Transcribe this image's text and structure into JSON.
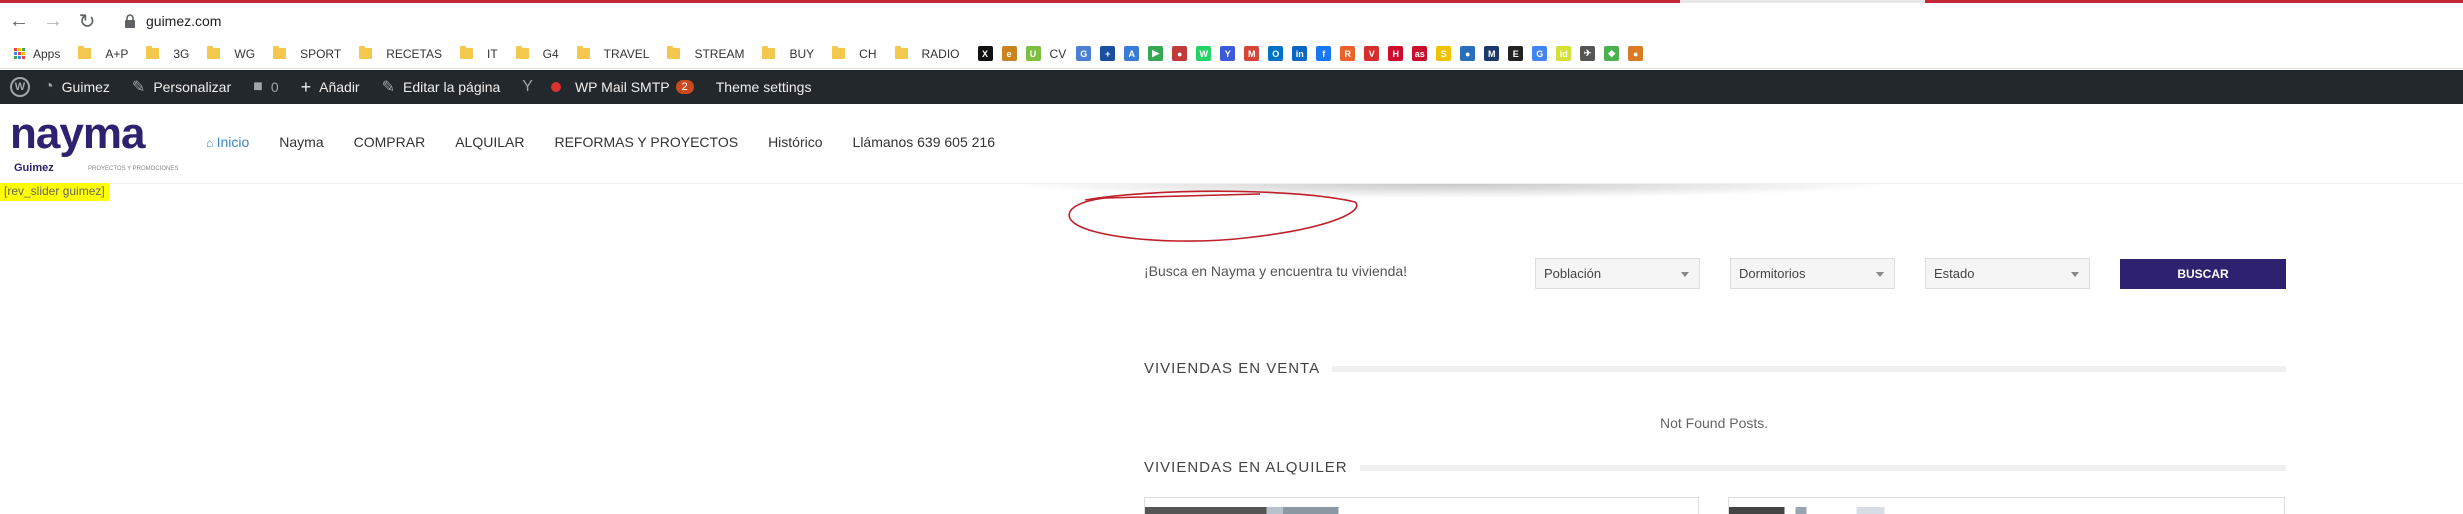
{
  "browser": {
    "url": "guimez.com"
  },
  "bookmarks": [
    {
      "label": "Apps",
      "kind": "apps"
    },
    {
      "label": "A+P",
      "kind": "folder"
    },
    {
      "label": "3G",
      "kind": "folder"
    },
    {
      "label": "WG",
      "kind": "folder"
    },
    {
      "label": "SPORT",
      "kind": "folder"
    },
    {
      "label": "RECETAS",
      "kind": "folder"
    },
    {
      "label": "IT",
      "kind": "folder"
    },
    {
      "label": "G4",
      "kind": "folder"
    },
    {
      "label": "TRAVEL",
      "kind": "folder"
    },
    {
      "label": "STREAM",
      "kind": "folder"
    },
    {
      "label": "BUY",
      "kind": "folder"
    },
    {
      "label": "CH",
      "kind": "folder"
    },
    {
      "label": "RADIO",
      "kind": "folder"
    }
  ],
  "bookmark_icons": [
    {
      "glyph": "X",
      "color": "#111111"
    },
    {
      "glyph": "e",
      "color": "#c9841f"
    },
    {
      "glyph": "U",
      "color": "#7fbf3f",
      "label": "CV"
    },
    {
      "glyph": "G",
      "color": "#4a7fd4"
    },
    {
      "glyph": "+",
      "color": "#1a4fa0"
    },
    {
      "glyph": "A",
      "color": "#3a7bd5"
    },
    {
      "glyph": "▶",
      "color": "#34a853"
    },
    {
      "glyph": "●",
      "color": "#c23b3b"
    },
    {
      "glyph": "W",
      "color": "#25d366"
    },
    {
      "glyph": "Y",
      "color": "#3b5bdb"
    },
    {
      "glyph": "M",
      "color": "#d44638"
    },
    {
      "glyph": "O",
      "color": "#0072c6"
    },
    {
      "glyph": "in",
      "color": "#0a66c2"
    },
    {
      "glyph": "f",
      "color": "#1877f2"
    },
    {
      "glyph": "R",
      "color": "#e8632b"
    },
    {
      "glyph": "V",
      "color": "#d62d2d"
    },
    {
      "glyph": "H",
      "color": "#cf0a2c"
    },
    {
      "glyph": "as",
      "color": "#c8102e"
    },
    {
      "glyph": "S",
      "color": "#f2c200"
    },
    {
      "glyph": "●",
      "color": "#2a6fbb"
    },
    {
      "glyph": "M",
      "color": "#1b3a6b"
    },
    {
      "glyph": "E",
      "color": "#222222"
    },
    {
      "glyph": "G",
      "color": "#4285f4"
    },
    {
      "glyph": "id",
      "color": "#d2e038"
    },
    {
      "glyph": "✈",
      "color": "#555555"
    },
    {
      "glyph": "◆",
      "color": "#4caf50"
    },
    {
      "glyph": "●",
      "color": "#d97b22"
    }
  ],
  "adminbar": {
    "site": "Guimez",
    "customize": "Personalizar",
    "comments_count": "0",
    "new": "Añadir",
    "edit_page": "Editar la página",
    "wp_mail": "WP Mail SMTP",
    "wp_mail_badge": "2",
    "theme_settings": "Theme settings"
  },
  "logo": {
    "word": "nayma",
    "sub": "Guimez",
    "tag": "PROYECTOS Y PROMOCIONES"
  },
  "nav": [
    {
      "label": "Inicio",
      "active": true
    },
    {
      "label": "Nayma"
    },
    {
      "label": "COMPRAR"
    },
    {
      "label": "ALQUILAR"
    },
    {
      "label": "REFORMAS Y PROYECTOS"
    },
    {
      "label": "Histórico"
    },
    {
      "label": "Llámanos 639 605 216"
    }
  ],
  "shortcode": "[rev_slider guimez]",
  "search": {
    "intro": "¡Busca en Nayma y encuentra tu vivienda!",
    "poblacion": "Población",
    "dormitorios": "Dormitorios",
    "estado": "Estado",
    "button": "BUSCAR"
  },
  "sections": {
    "venta": "VIVIENDAS EN VENTA",
    "not_found": "Not Found Posts.",
    "alquiler": "VIVIENDAS EN ALQUILER"
  },
  "colors": {
    "brand": "#2e2170",
    "admin_bar": "#23282d",
    "annotation": "#c0202a"
  }
}
